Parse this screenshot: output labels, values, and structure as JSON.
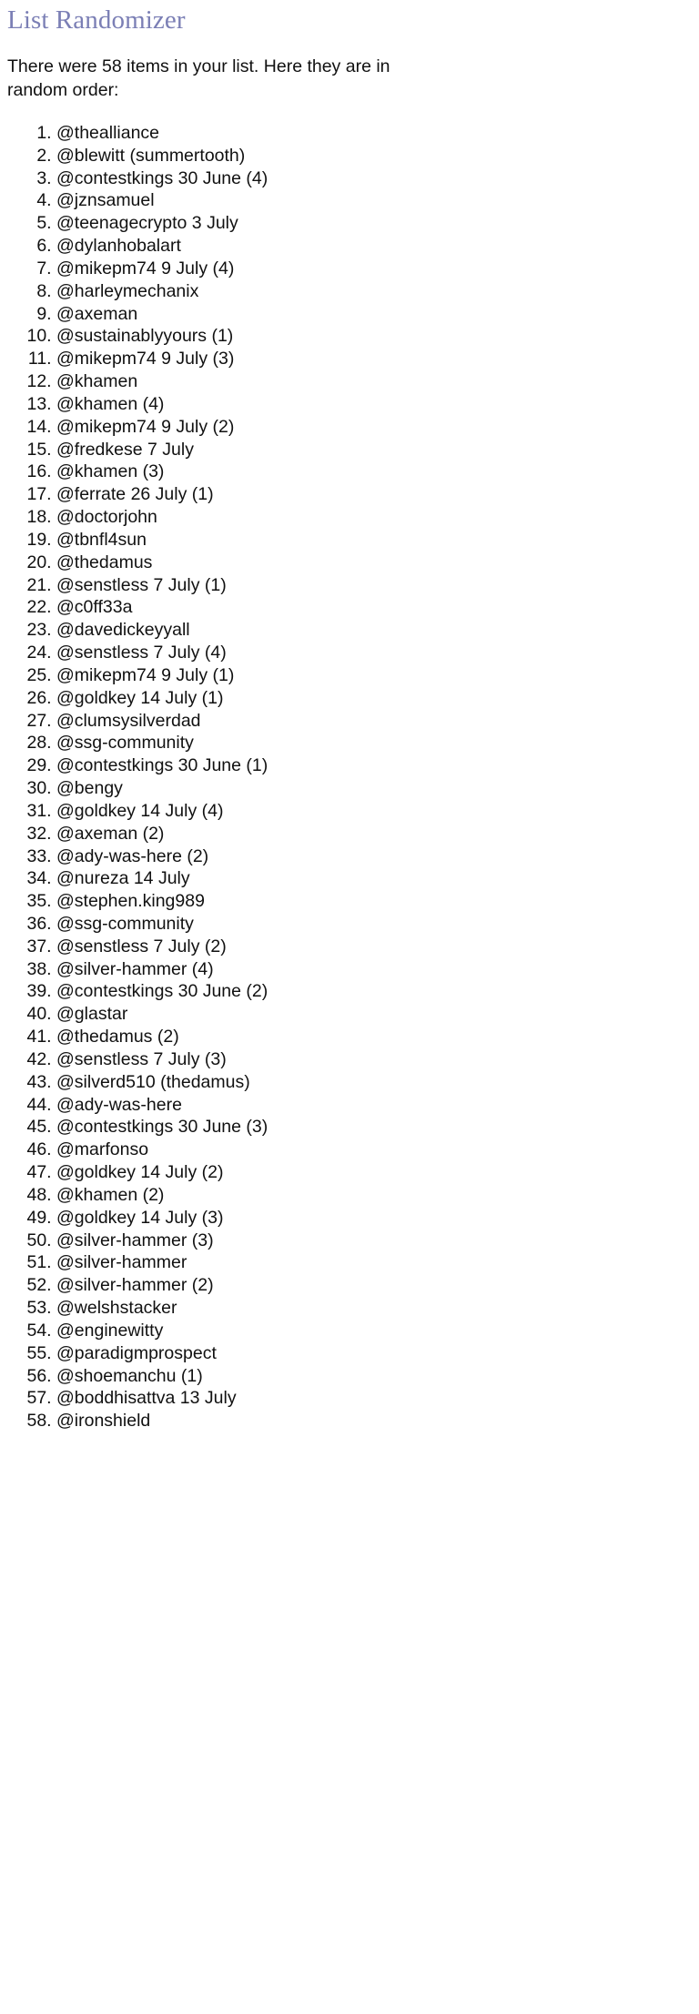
{
  "page": {
    "title": "List Randomizer",
    "intro": "There were 58 items in your list. Here they are in random order:",
    "item_count": 58,
    "title_color": "#7b7fb5",
    "text_color": "#111111",
    "background_color": "#ffffff"
  },
  "results": [
    "@thealliance",
    "@blewitt (summertooth)",
    "@contestkings 30 June (4)",
    "@jznsamuel",
    "@teenagecrypto 3 July",
    "@dylanhobalart",
    "@mikepm74 9 July (4)",
    "@harleymechanix",
    "@axeman",
    "@sustainablyyours (1)",
    "@mikepm74 9 July (3)",
    "@khamen",
    "@khamen (4)",
    "@mikepm74 9 July (2)",
    "@fredkese 7 July",
    "@khamen (3)",
    "@ferrate 26 July (1)",
    "@doctorjohn",
    "@tbnfl4sun",
    "@thedamus",
    "@senstless 7 July (1)",
    "@c0ff33a",
    "@davedickeyyall",
    "@senstless 7 July (4)",
    "@mikepm74 9 July (1)",
    "@goldkey 14 July (1)",
    "@clumsysilverdad",
    "@ssg-community",
    "@contestkings 30 June (1)",
    "@bengy",
    "@goldkey 14 July (4)",
    "@axeman (2)",
    "@ady-was-here (2)",
    "@nureza 14 July",
    "@stephen.king989",
    "@ssg-community",
    "@senstless 7 July (2)",
    "@silver-hammer (4)",
    "@contestkings 30 June (2)",
    "@glastar",
    "@thedamus (2)",
    "@senstless 7 July (3)",
    "@silverd510 (thedamus)",
    "@ady-was-here",
    "@contestkings 30 June (3)",
    "@marfonso",
    "@goldkey 14 July (2)",
    "@khamen (2)",
    "@goldkey 14 July (3)",
    "@silver-hammer (3)",
    "@silver-hammer",
    "@silver-hammer (2)",
    "@welshstacker",
    "@enginewitty",
    "@paradigmprospect",
    "@shoemanchu (1)",
    "@boddhisattva 13 July",
    "@ironshield"
  ]
}
